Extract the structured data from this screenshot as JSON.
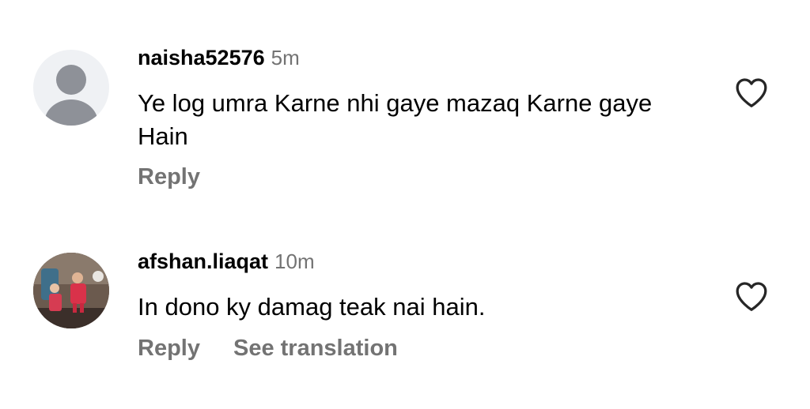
{
  "comments": [
    {
      "username": "naisha52576",
      "time": "5m",
      "text": "Ye log  umra Karne nhi gaye mazaq Karne gaye Hain",
      "reply_label": "Reply"
    },
    {
      "username": "afshan.liaqat",
      "time": "10m",
      "text": "In dono ky damag teak nai hain.",
      "reply_label": "Reply",
      "translation_label": "See translation"
    }
  ],
  "icons": {
    "like": "heart-outline-icon",
    "default_avatar": "person-placeholder-icon"
  },
  "colors": {
    "secondary_text": "#737373",
    "avatar_placeholder_bg": "#eff1f4",
    "avatar_placeholder_fg": "#8e9198"
  }
}
